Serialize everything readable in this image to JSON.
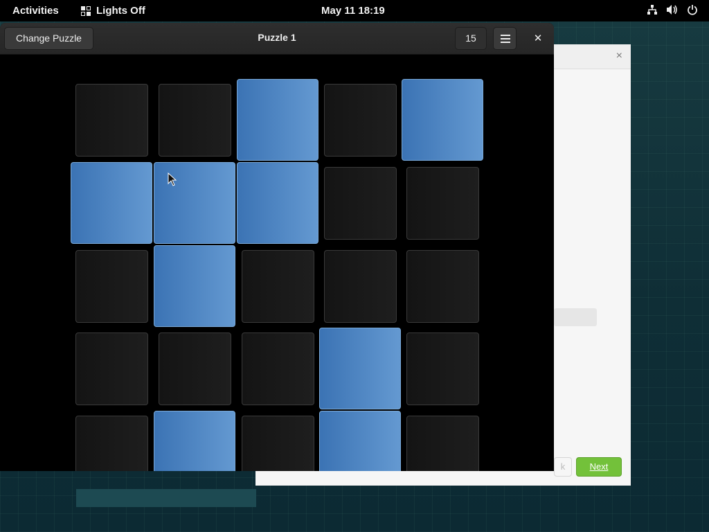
{
  "topbar": {
    "activities": "Activities",
    "app_name": "Lights Off",
    "clock": "May 11  18:19",
    "tray_icons": [
      "network-icon",
      "volume-icon",
      "power-icon"
    ]
  },
  "window": {
    "change_puzzle_label": "Change Puzzle",
    "title": "Puzzle 1",
    "level_value": "15",
    "menu_icon": "hamburger-menu-icon",
    "close_icon": "close-icon",
    "close_glyph": "✕"
  },
  "board": {
    "rows": 5,
    "cols": 5,
    "lights": [
      [
        false,
        false,
        true,
        false,
        true
      ],
      [
        true,
        true,
        true,
        false,
        false
      ],
      [
        false,
        true,
        false,
        false,
        false
      ],
      [
        false,
        false,
        false,
        true,
        false
      ],
      [
        false,
        true,
        false,
        true,
        false
      ]
    ],
    "colors": {
      "on": "#4f86c4",
      "off": "#1a1a1a"
    }
  },
  "background_window": {
    "close_glyph": "×",
    "back_label": "k",
    "next_label": "Next",
    "next_color": "#73c13a"
  }
}
